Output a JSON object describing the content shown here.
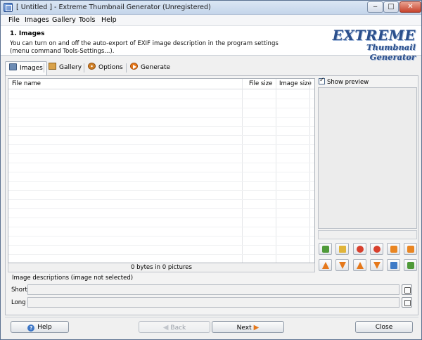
{
  "window": {
    "title": "[ Untitled ] - Extreme Thumbnail Generator (Unregistered)",
    "controls": [
      "‒",
      "□",
      "✕"
    ]
  },
  "menu": [
    "File",
    "Images",
    "Gallery",
    "Tools",
    "Help"
  ],
  "header": {
    "step_title": "1. Images",
    "description": "You can turn on and off the auto-export of EXIF image description in the program settings (menu command Tools-Settings...).",
    "logo_line1": "EXTREME",
    "logo_line2": "Thumbnail Generator"
  },
  "tabs": [
    {
      "label": "Images",
      "icon": "images-icon",
      "active": true
    },
    {
      "label": "Gallery",
      "icon": "gallery-icon",
      "active": false
    },
    {
      "label": "Options",
      "icon": "options-icon",
      "active": false
    },
    {
      "label": "Generate",
      "icon": "generate-icon",
      "active": false
    }
  ],
  "file_list": {
    "columns": [
      "File name",
      "File size",
      "Image size"
    ],
    "rows": [],
    "status": "0 bytes in 0 pictures"
  },
  "preview": {
    "checkbox_label": "Show preview",
    "checked": true
  },
  "toolbar": {
    "row1": [
      "add-image-icon",
      "add-folder-icon",
      "remove-image-icon",
      "clear-all-icon",
      "undo-icon",
      "redo-icon"
    ],
    "row2": [
      "move-up-icon",
      "move-down-icon",
      "move-top-icon",
      "move-bottom-icon",
      "sort-icon",
      "export-icon"
    ]
  },
  "descriptions": {
    "title": "Image descriptions (image not selected)",
    "short_label": "Short",
    "long_label": "Long",
    "short_value": "",
    "long_value": ""
  },
  "buttons": {
    "help": "Help",
    "back": "Back",
    "next": "Next",
    "close": "Close"
  }
}
